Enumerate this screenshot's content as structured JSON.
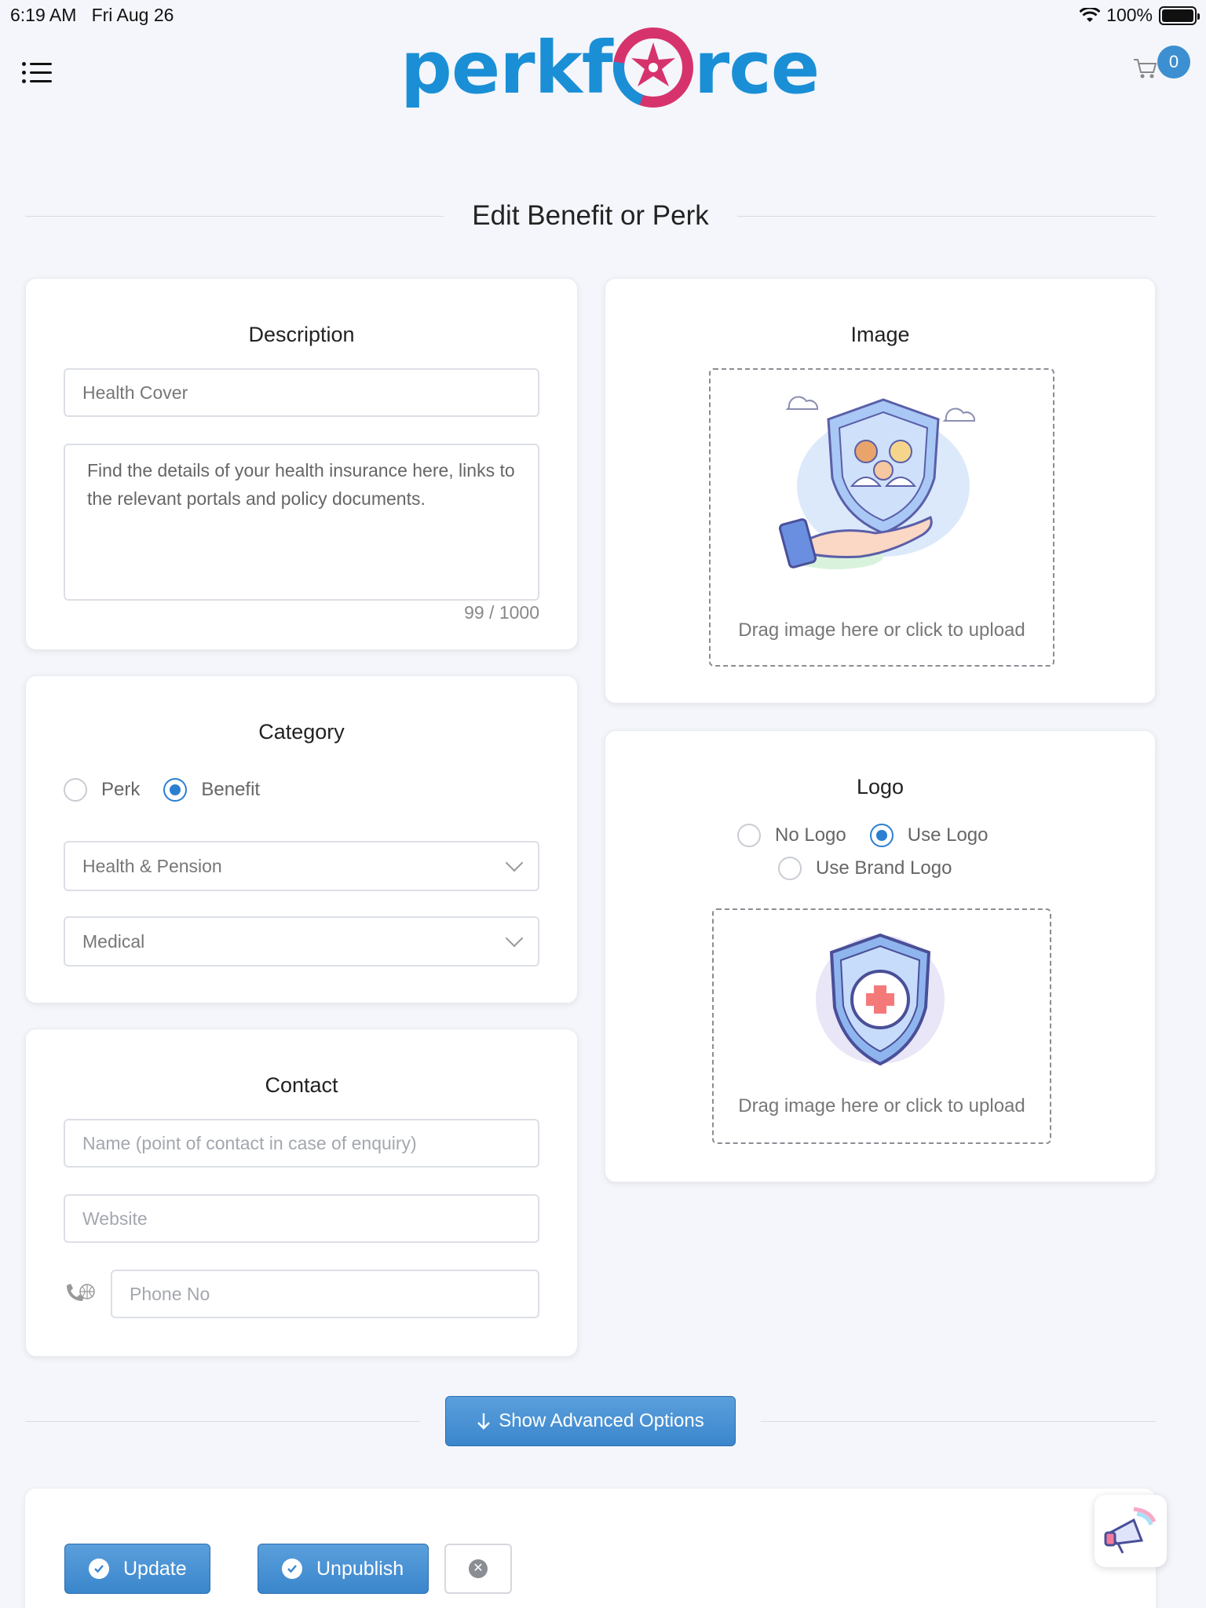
{
  "status_bar": {
    "time": "6:19 AM",
    "date": "Fri Aug 26",
    "battery": "100%"
  },
  "header": {
    "logo_left": "perkf",
    "logo_right": "rce",
    "cart_count": "0",
    "brand_colors": {
      "blue": "#1a8fd6",
      "magenta": "#d6336c"
    }
  },
  "page": {
    "title": "Edit Benefit or Perk"
  },
  "description": {
    "title": "Description",
    "name_value": "Health Cover",
    "body_value": "Find the details of your health insurance here, links to the relevant portals and policy documents.",
    "counter": "99 / 1000"
  },
  "category": {
    "title": "Category",
    "options": [
      "Perk",
      "Benefit"
    ],
    "selected": "Benefit",
    "primary_select": "Health & Pension",
    "secondary_select": "Medical"
  },
  "contact": {
    "title": "Contact",
    "name_placeholder": "Name (point of contact in case of enquiry)",
    "website_placeholder": "Website",
    "phone_placeholder": "Phone No"
  },
  "image": {
    "title": "Image",
    "dropzone_text": "Drag image here or click to upload"
  },
  "logo": {
    "title": "Logo",
    "options": [
      "No Logo",
      "Use Logo",
      "Use Brand Logo"
    ],
    "selected": "Use Logo",
    "dropzone_text": "Drag image here or click to upload"
  },
  "advanced": {
    "button_label": "Show Advanced Options"
  },
  "actions": {
    "update_label": "Update",
    "unpublish_label": "Unpublish"
  }
}
